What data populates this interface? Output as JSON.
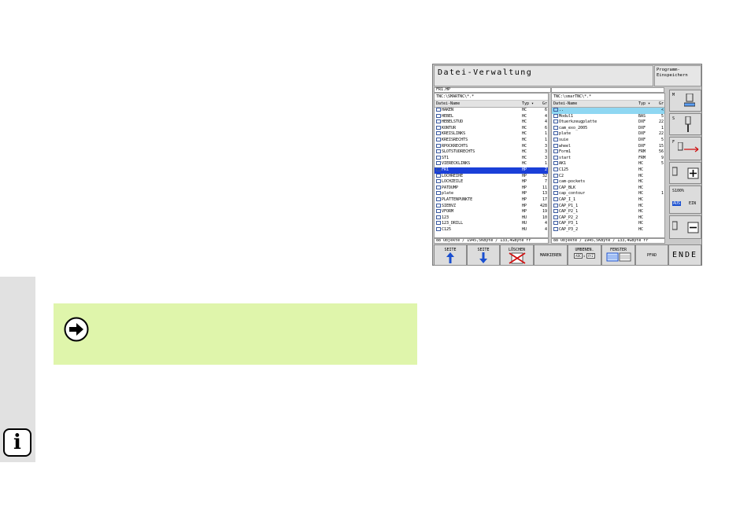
{
  "window": {
    "title": "Datei-Verwaltung",
    "program_box": [
      "Programm-",
      "Einspeichern"
    ]
  },
  "path_left": "FR1.HP",
  "left_pane": {
    "path": "TNC:\\SMARTNC\\*.*",
    "columns": [
      "Datei-Name",
      "Typ ▾",
      "Gr"
    ],
    "rows": [
      {
        "name": "HAKEN",
        "typ": "HC",
        "gr": "6"
      },
      {
        "name": "HEBEL",
        "typ": "HC",
        "gr": "4"
      },
      {
        "name": "HEBELSTUD",
        "typ": "HC",
        "gr": "4"
      },
      {
        "name": "KONTUR",
        "typ": "HC",
        "gr": "6"
      },
      {
        "name": "KREISLINKS",
        "typ": "HC",
        "gr": "1"
      },
      {
        "name": "KREISRECHTS",
        "typ": "HC",
        "gr": "1"
      },
      {
        "name": "RPOCKRECHTS",
        "typ": "HC",
        "gr": "3"
      },
      {
        "name": "SLOTSTUDRECHTS",
        "typ": "HC",
        "gr": "3"
      },
      {
        "name": "ST1",
        "typ": "HC",
        "gr": "3"
      },
      {
        "name": "VIERECKLINKS",
        "typ": "HC",
        "gr": "1"
      },
      {
        "name": "FR1",
        "typ": "HP",
        "gr": "2",
        "selected": true
      },
      {
        "name": "LOCHREIHE",
        "typ": "HP",
        "gr": "32"
      },
      {
        "name": "LOCHZEILE",
        "typ": "HP",
        "gr": "7"
      },
      {
        "name": "PATDUMP",
        "typ": "HP",
        "gr": "11"
      },
      {
        "name": "plate",
        "typ": "HP",
        "gr": "13"
      },
      {
        "name": "PLATTENPUNKTE",
        "typ": "HP",
        "gr": "17"
      },
      {
        "name": "SIEBVZ",
        "typ": "HP",
        "gr": "428"
      },
      {
        "name": "VFORM",
        "typ": "HP",
        "gr": "19"
      },
      {
        "name": "123",
        "typ": "HU",
        "gr": "10"
      },
      {
        "name": "123_DRILL",
        "typ": "HU",
        "gr": "4"
      },
      {
        "name": "C125",
        "typ": "HU",
        "gr": "4"
      }
    ],
    "status": "88 Objekte / 1945,5KByte / 133,4GByte fr"
  },
  "right_pane": {
    "path": "TNC:\\smarTNC\\*.*",
    "columns": [
      "Datei-Name",
      "Typ ▾",
      "Gr"
    ],
    "rows": [
      {
        "name": "..",
        "typ": "",
        "gr": "<",
        "selected": true
      },
      {
        "name": "Modul1",
        "typ": "BAS",
        "gr": "5"
      },
      {
        "name": "Otuerkzeugplatte",
        "typ": "DXF",
        "gr": "22"
      },
      {
        "name": "cam_exo_2005",
        "typ": "DXF",
        "gr": "1"
      },
      {
        "name": "plate",
        "typ": "DXF",
        "gr": "22"
      },
      {
        "name": "suie",
        "typ": "DXF",
        "gr": "5"
      },
      {
        "name": "wheel",
        "typ": "DXF",
        "gr": "15"
      },
      {
        "name": "Form1",
        "typ": "FRM",
        "gr": "56"
      },
      {
        "name": "start",
        "typ": "FRM",
        "gr": "9"
      },
      {
        "name": "AK1",
        "typ": "HC",
        "gr": "5"
      },
      {
        "name": "C125",
        "typ": "HC",
        "gr": ""
      },
      {
        "name": "C2",
        "typ": "HC",
        "gr": ""
      },
      {
        "name": "cam-pockets",
        "typ": "HC",
        "gr": ""
      },
      {
        "name": "CAP_BLK",
        "typ": "HC",
        "gr": ""
      },
      {
        "name": "cap_contour",
        "typ": "HC",
        "gr": "1"
      },
      {
        "name": "CAP_I_1",
        "typ": "HC",
        "gr": ""
      },
      {
        "name": "CAP_P1_1",
        "typ": "HC",
        "gr": ""
      },
      {
        "name": "CAP_P2_1",
        "typ": "HC",
        "gr": ""
      },
      {
        "name": "CAP_P2_2",
        "typ": "HC",
        "gr": ""
      },
      {
        "name": "CAP_P3_1",
        "typ": "HC",
        "gr": ""
      },
      {
        "name": "CAP_P3_2",
        "typ": "HC",
        "gr": ""
      }
    ],
    "status": "88 Objekte / 1945,5KByte / 133,4GByte fr"
  },
  "softkeys": {
    "seite_up": "SEITE",
    "seite_down": "SEITE",
    "loeschen": "LÖSCHEN",
    "markieren": "MARKIEREN",
    "umbenen": "UMBENEN.",
    "umbenen_from": "ABC",
    "umbenen_to": "XYZ",
    "fenster": "FENSTER",
    "pfad": "PFAD",
    "ende": "ENDE"
  },
  "side_keys": {
    "m": "M",
    "s": "S",
    "f": "F",
    "s100": "S100%",
    "aus": "AUS",
    "ein": "EIN"
  },
  "icons": {
    "note": "arrow-right-circle-icon",
    "info": "info-icon"
  },
  "colors": {
    "note_bg": "#dff5ab",
    "selection": "#1a3fd8",
    "selection_alt": "#8fd7f2"
  }
}
